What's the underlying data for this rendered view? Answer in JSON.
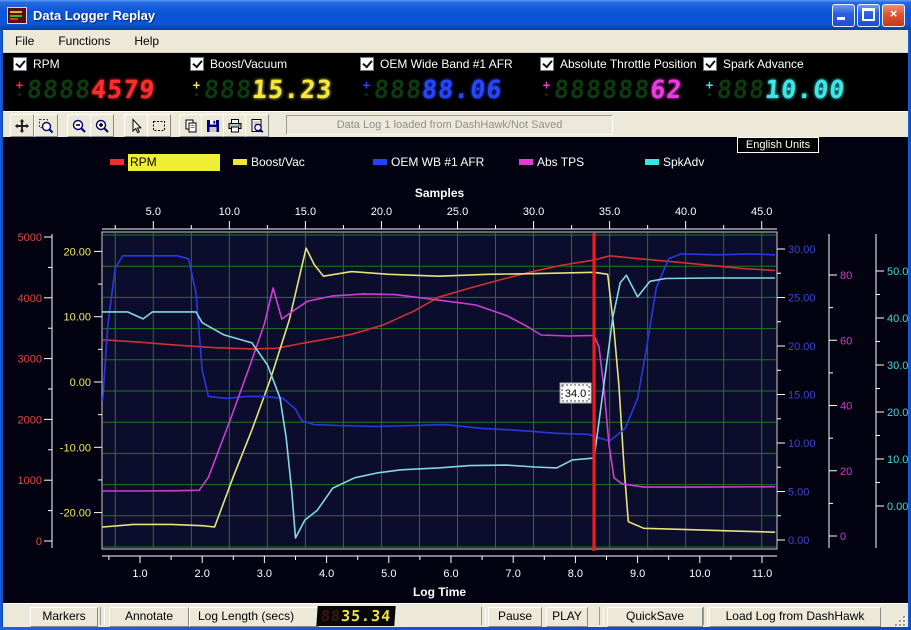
{
  "window": {
    "title": "Data Logger Replay",
    "controls": {
      "minimize": "minimize",
      "maximize": "maximize",
      "close": "close"
    }
  },
  "menu": {
    "items": [
      "File",
      "Functions",
      "Help"
    ]
  },
  "channels": [
    {
      "label": "RPM",
      "checked": true,
      "color": "#ff2e2e",
      "ghost": "8888",
      "value": "4579"
    },
    {
      "label": "Boost/Vacuum",
      "checked": true,
      "color": "#f5e73c",
      "ghost": "888",
      "value": "15.23"
    },
    {
      "label": "OEM Wide Band #1 AFR",
      "checked": true,
      "color": "#2746ff",
      "ghost": "888",
      "value": "88.06"
    },
    {
      "label": "Absolute Throttle Position",
      "checked": true,
      "color": "#ee3ae0",
      "ghost": "888888",
      "value": "62"
    },
    {
      "label": "Spark Advance",
      "checked": true,
      "color": "#3ee8e8",
      "ghost": "888",
      "value": "10.00"
    }
  ],
  "toolbar": {
    "status": "Data Log 1 loaded from DashHawk/Not Saved",
    "buttons": [
      "pan",
      "zoom-window",
      "zoom-out",
      "zoom-in",
      "cursor",
      "select-region",
      "copy",
      "save",
      "print",
      "print-preview"
    ]
  },
  "units_label": "English Units",
  "legend": [
    {
      "label": "RPM",
      "color": "#f03030",
      "highlighted": true
    },
    {
      "label": "Boost/Vac",
      "color": "#f0e63a",
      "highlighted": false
    },
    {
      "label": "OEM WB #1 AFR",
      "color": "#2244ff",
      "highlighted": false
    },
    {
      "label": "Abs TPS",
      "color": "#e03ad8",
      "highlighted": false
    },
    {
      "label": "SpkAdv",
      "color": "#3ae4e4",
      "highlighted": false
    }
  ],
  "chart_data": {
    "type": "line",
    "title": "",
    "grid": true,
    "legend_position": "top",
    "axes": {
      "top": {
        "title": "Samples",
        "tick_labels": [
          "5.0",
          "10.0",
          "15.0",
          "20.0",
          "25.0",
          "30.0",
          "35.0",
          "40.0",
          "45.0"
        ],
        "tick_values": [
          5,
          10,
          15,
          20,
          25,
          30,
          35,
          40,
          45
        ],
        "minor_step": 2.5,
        "color": "#ffffff"
      },
      "bottom": {
        "title": "Log Time",
        "tick_labels": [
          "1.0",
          "2.0",
          "3.0",
          "4.0",
          "5.0",
          "6.0",
          "7.0",
          "8.0",
          "9.0",
          "10.0",
          "11.0"
        ],
        "tick_values": [
          1,
          2,
          3,
          4,
          5,
          6,
          7,
          8,
          9,
          10,
          11
        ],
        "minor_step": 0.5,
        "color": "#ffffff"
      },
      "rpm": {
        "side": "left",
        "color": "#e84545",
        "tick_labels": [
          "5000",
          "4000",
          "3000",
          "2000",
          "1000",
          "0"
        ],
        "tick_values": [
          5000,
          4000,
          3000,
          2000,
          1000,
          0
        ],
        "minor_step": 500
      },
      "boost": {
        "side": "left",
        "color": "#efe75a",
        "tick_labels": [
          "20.00",
          "10.00",
          "0.00",
          "-10.00",
          "-20.00"
        ],
        "tick_values": [
          20,
          10,
          0,
          -10,
          -20
        ],
        "minor_step": 5
      },
      "afr": {
        "side": "right",
        "color": "#3a46d8",
        "tick_labels": [
          "30.00",
          "25.00",
          "20.00",
          "15.00",
          "10.00",
          "5.00",
          "0.00"
        ],
        "tick_values": [
          30,
          25,
          20,
          15,
          10,
          5,
          0
        ],
        "minor_step": 2.5
      },
      "tps": {
        "side": "right",
        "color": "#d23cc8",
        "tick_labels": [
          "80",
          "60",
          "40",
          "20",
          "0"
        ],
        "tick_values": [
          80,
          60,
          40,
          20,
          0
        ],
        "minor_step": 10
      },
      "spark": {
        "side": "right",
        "color": "#40d8d8",
        "tick_labels": [
          "50.0",
          "40.0",
          "30.0",
          "20.0",
          "10.0",
          "0.00"
        ],
        "tick_values": [
          50,
          40,
          30,
          20,
          10,
          0
        ],
        "minor_step": 5
      }
    },
    "cursor": {
      "time": 8.3,
      "label": "34.0"
    },
    "series": [
      {
        "name": "RPM",
        "axis": "rpm",
        "color": "#cf3232",
        "points": [
          [
            0.4,
            3310
          ],
          [
            1.0,
            3270
          ],
          [
            1.6,
            3220
          ],
          [
            2.2,
            3180
          ],
          [
            2.8,
            3160
          ],
          [
            3.2,
            3170
          ],
          [
            3.6,
            3250
          ],
          [
            4.0,
            3320
          ],
          [
            4.4,
            3400
          ],
          [
            4.9,
            3550
          ],
          [
            5.4,
            3780
          ],
          [
            5.8,
            4010
          ],
          [
            6.3,
            4160
          ],
          [
            6.8,
            4300
          ],
          [
            7.3,
            4430
          ],
          [
            7.8,
            4540
          ],
          [
            8.3,
            4620
          ],
          [
            8.55,
            4690
          ],
          [
            9.0,
            4645
          ],
          [
            9.6,
            4590
          ],
          [
            10.2,
            4530
          ],
          [
            10.7,
            4480
          ],
          [
            11.2,
            4450
          ]
        ]
      },
      {
        "name": "Boost/Vac",
        "axis": "boost",
        "color": "#e4e47a",
        "points": [
          [
            0.4,
            -22.2
          ],
          [
            0.9,
            -21.8
          ],
          [
            1.5,
            -21.8
          ],
          [
            2.0,
            -22.0
          ],
          [
            2.2,
            -22.2
          ],
          [
            2.5,
            -14.5
          ],
          [
            2.8,
            -7.3
          ],
          [
            3.1,
            0.5
          ],
          [
            3.4,
            9.5
          ],
          [
            3.67,
            20.5
          ],
          [
            3.8,
            18.0
          ],
          [
            3.95,
            16.2
          ],
          [
            4.4,
            16.9
          ],
          [
            5.0,
            16.5
          ],
          [
            5.8,
            16.2
          ],
          [
            6.6,
            16.5
          ],
          [
            7.4,
            16.6
          ],
          [
            8.3,
            16.8
          ],
          [
            8.52,
            16.5
          ],
          [
            8.62,
            8.0
          ],
          [
            8.7,
            -0.5
          ],
          [
            8.78,
            -12.7
          ],
          [
            8.85,
            -21.4
          ],
          [
            9.1,
            -22.4
          ],
          [
            9.8,
            -22.6
          ],
          [
            10.5,
            -22.8
          ],
          [
            11.2,
            -23.0
          ]
        ]
      },
      {
        "name": "OEM WB #1 AFR",
        "axis": "afr",
        "color": "#2a38e0",
        "points": [
          [
            0.4,
            14.4
          ],
          [
            0.48,
            22.0
          ],
          [
            0.6,
            28.0
          ],
          [
            0.72,
            29.3
          ],
          [
            1.2,
            29.3
          ],
          [
            1.6,
            29.3
          ],
          [
            1.78,
            29.0
          ],
          [
            1.9,
            25.5
          ],
          [
            2.0,
            17.5
          ],
          [
            2.1,
            14.8
          ],
          [
            2.4,
            14.6
          ],
          [
            2.7,
            14.8
          ],
          [
            3.0,
            14.8
          ],
          [
            3.3,
            14.6
          ],
          [
            3.5,
            13.5
          ],
          [
            3.6,
            12.3
          ],
          [
            3.8,
            11.9
          ],
          [
            4.2,
            11.8
          ],
          [
            4.8,
            11.7
          ],
          [
            5.4,
            11.8
          ],
          [
            5.9,
            11.9
          ],
          [
            6.5,
            11.5
          ],
          [
            7.1,
            11.3
          ],
          [
            7.7,
            11.0
          ],
          [
            8.2,
            10.9
          ],
          [
            8.55,
            10.2
          ],
          [
            8.8,
            11.5
          ],
          [
            9.0,
            14.6
          ],
          [
            9.15,
            20.0
          ],
          [
            9.3,
            26.0
          ],
          [
            9.5,
            29.0
          ],
          [
            9.7,
            29.5
          ],
          [
            10.3,
            29.4
          ],
          [
            10.8,
            29.5
          ],
          [
            11.2,
            29.4
          ]
        ]
      },
      {
        "name": "Abs TPS",
        "axis": "tps",
        "color": "#cc3ed2",
        "points": [
          [
            0.4,
            13.8
          ],
          [
            1.0,
            13.8
          ],
          [
            1.6,
            13.9
          ],
          [
            1.95,
            14.0
          ],
          [
            2.1,
            18.0
          ],
          [
            2.45,
            35.6
          ],
          [
            2.77,
            52.4
          ],
          [
            3.0,
            65.0
          ],
          [
            3.14,
            76.0
          ],
          [
            3.28,
            66.5
          ],
          [
            3.5,
            69.5
          ],
          [
            3.7,
            72.0
          ],
          [
            4.1,
            73.6
          ],
          [
            4.6,
            74.2
          ],
          [
            5.1,
            74.0
          ],
          [
            5.8,
            72.3
          ],
          [
            6.4,
            70.8
          ],
          [
            6.9,
            67.5
          ],
          [
            7.2,
            64.5
          ],
          [
            7.45,
            61.6
          ],
          [
            7.9,
            61.3
          ],
          [
            8.3,
            61.5
          ],
          [
            8.38,
            58.0
          ],
          [
            8.46,
            45.0
          ],
          [
            8.54,
            28.0
          ],
          [
            8.62,
            17.8
          ],
          [
            8.75,
            16.0
          ],
          [
            9.1,
            15.0
          ],
          [
            10.0,
            15.0
          ],
          [
            11.2,
            15.1
          ]
        ]
      },
      {
        "name": "SpkAdv",
        "axis": "spark",
        "color": "#82d8e4",
        "points": [
          [
            0.4,
            41.3
          ],
          [
            0.8,
            41.3
          ],
          [
            1.05,
            39.8
          ],
          [
            1.2,
            41.3
          ],
          [
            1.9,
            41.3
          ],
          [
            2.0,
            39.0
          ],
          [
            2.35,
            36.4
          ],
          [
            2.8,
            34.7
          ],
          [
            3.05,
            30.0
          ],
          [
            3.25,
            23.0
          ],
          [
            3.35,
            14.5
          ],
          [
            3.44,
            3.0
          ],
          [
            3.5,
            -6.8
          ],
          [
            3.65,
            -3.0
          ],
          [
            3.85,
            -0.9
          ],
          [
            4.1,
            3.8
          ],
          [
            4.45,
            6.0
          ],
          [
            4.8,
            7.0
          ],
          [
            5.2,
            7.7
          ],
          [
            5.8,
            8.1
          ],
          [
            6.3,
            8.6
          ],
          [
            6.9,
            8.7
          ],
          [
            7.35,
            8.3
          ],
          [
            7.7,
            8.1
          ],
          [
            7.95,
            9.8
          ],
          [
            8.3,
            10.2
          ],
          [
            8.45,
            25.0
          ],
          [
            8.6,
            40.0
          ],
          [
            8.72,
            47.5
          ],
          [
            8.82,
            49.1
          ],
          [
            9.0,
            44.5
          ],
          [
            9.2,
            47.8
          ],
          [
            9.45,
            48.4
          ],
          [
            10.2,
            48.5
          ],
          [
            11.2,
            48.5
          ]
        ]
      }
    ]
  },
  "transport": {
    "markers": "Markers",
    "annotate": "Annotate",
    "log_length_label": "Log Length (secs)",
    "log_length_ghost": "88",
    "log_length_value": "35.34",
    "pause": "Pause",
    "play": "PLAY",
    "quicksave": "QuickSave",
    "load": "Load Log from DashHawk"
  }
}
